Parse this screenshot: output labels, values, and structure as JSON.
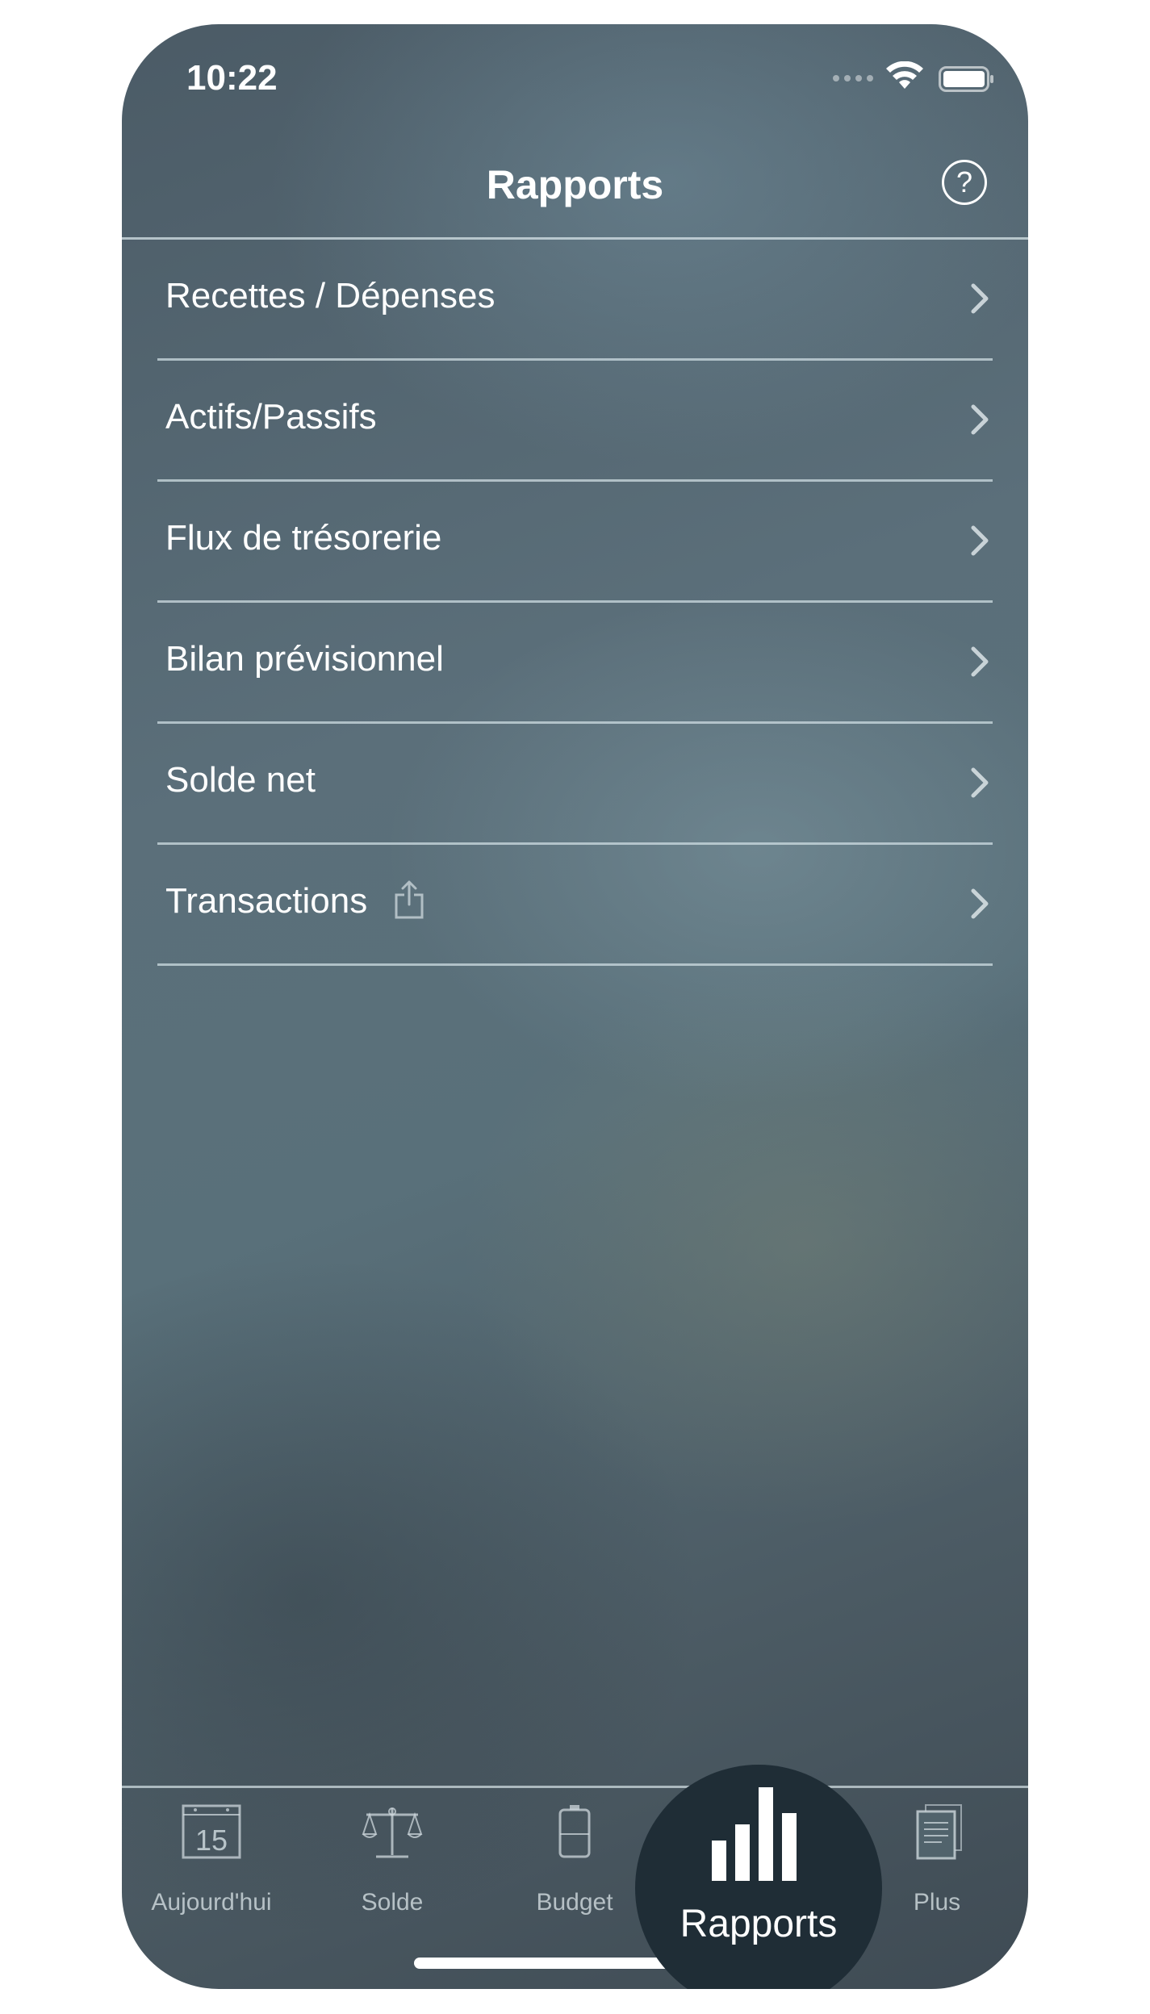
{
  "status_bar": {
    "time": "10:22",
    "icons": [
      "signal-icon",
      "wifi-icon",
      "battery-icon"
    ]
  },
  "nav": {
    "title": "Rapports",
    "help_label": "?",
    "help_icon": "question-circle-icon"
  },
  "reports": [
    {
      "label": "Recettes / Dépenses",
      "has_share": false
    },
    {
      "label": "Actifs/Passifs",
      "has_share": false
    },
    {
      "label": "Flux de trésorerie",
      "has_share": false
    },
    {
      "label": "Bilan prévisionnel",
      "has_share": false
    },
    {
      "label": "Solde net",
      "has_share": false
    },
    {
      "label": "Transactions",
      "has_share": true
    }
  ],
  "tab_bar": {
    "items": [
      {
        "label": "Aujourd'hui",
        "icon": "calendar-icon",
        "calendar_day": "15"
      },
      {
        "label": "Solde",
        "icon": "scale-icon"
      },
      {
        "label": "Budget",
        "icon": "budget-icon"
      },
      {
        "label": "Rapports",
        "icon": "bar-chart-icon",
        "active": true
      },
      {
        "label": "Plus",
        "icon": "document-icon"
      }
    ]
  },
  "colors": {
    "background_top": "#4b5b66",
    "background_mid": "#59707a",
    "active_tab": "#1f2d36",
    "text": "#ffffff",
    "inactive_tab_text": "#d2dce0"
  }
}
